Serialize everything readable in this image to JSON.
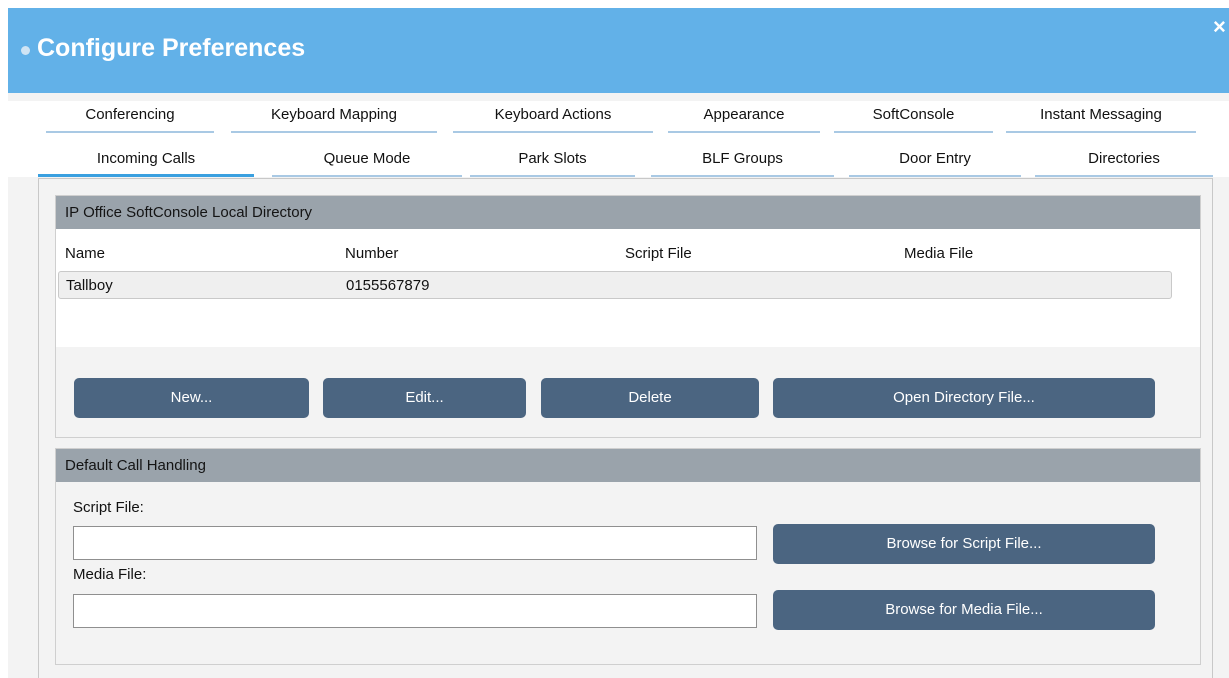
{
  "window": {
    "title": "Configure Preferences",
    "close_glyph": "×"
  },
  "tabs_row1": [
    {
      "label": "Conferencing"
    },
    {
      "label": "Keyboard Mapping"
    },
    {
      "label": "Keyboard Actions"
    },
    {
      "label": "Appearance"
    },
    {
      "label": "SoftConsole"
    },
    {
      "label": "Instant Messaging"
    }
  ],
  "tabs_row2": [
    {
      "label": "Incoming Calls",
      "active": true
    },
    {
      "label": "Queue Mode"
    },
    {
      "label": "Park Slots"
    },
    {
      "label": "BLF Groups"
    },
    {
      "label": "Door Entry"
    },
    {
      "label": "Directories"
    }
  ],
  "directory": {
    "header": "IP Office SoftConsole Local Directory",
    "columns": [
      "Name",
      "Number",
      "Script File",
      "Media File"
    ],
    "rows": [
      {
        "name": "Tallboy",
        "number": "0155567879",
        "script_file": "",
        "media_file": ""
      }
    ],
    "buttons": {
      "new": "New...",
      "edit": "Edit...",
      "delete": "Delete",
      "open": "Open Directory File..."
    }
  },
  "call_handling": {
    "header": "Default Call Handling",
    "script_label": "Script File:",
    "script_value": "",
    "media_label": "Media File:",
    "media_value": "",
    "browse_script": "Browse for Script File...",
    "browse_media": "Browse for Media File..."
  },
  "colors": {
    "titlebar": "#62b1e8",
    "button": "#4b6581",
    "group_header": "#9aa3ab",
    "active_tab": "#3aa0e0"
  }
}
